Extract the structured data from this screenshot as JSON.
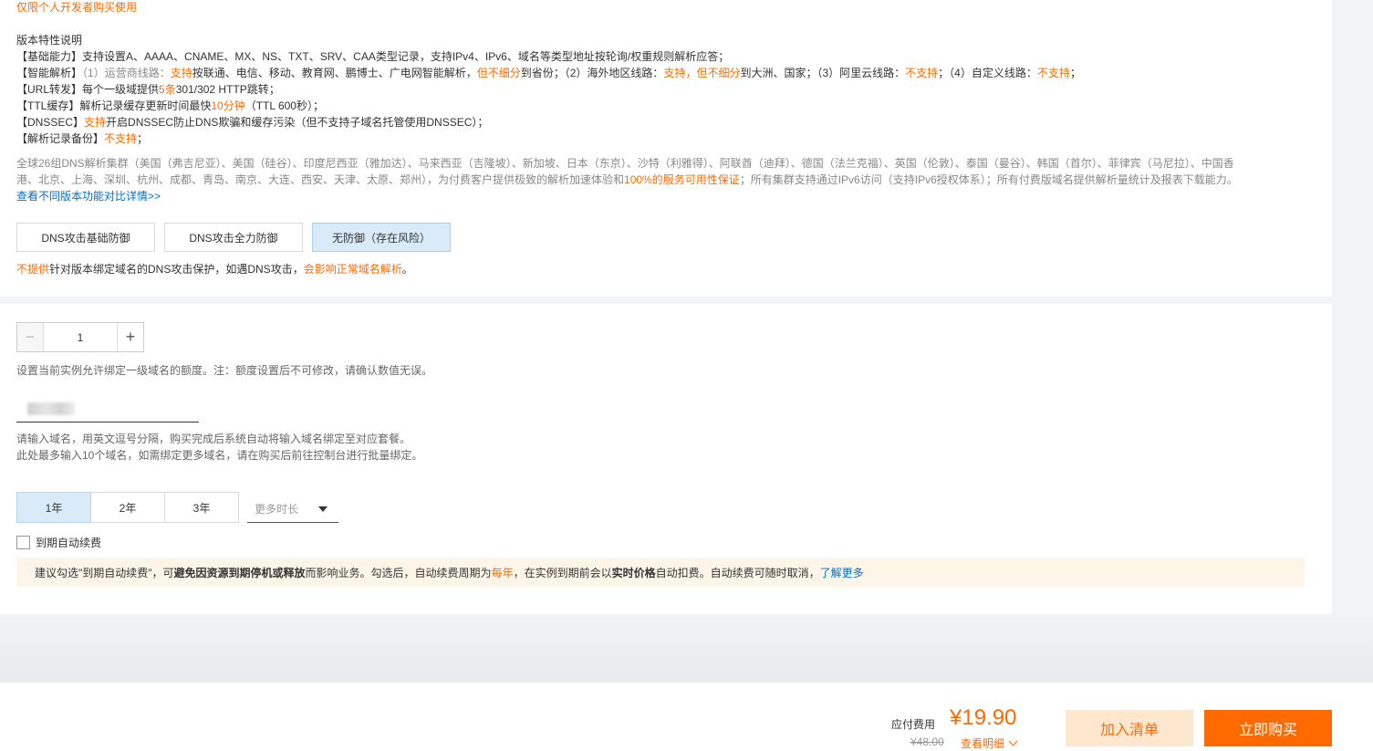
{
  "restriction_note": "仅限个人开发者购买使用",
  "features": {
    "heading": "版本特性说明",
    "basic": {
      "label": "【基础能力】",
      "text": "支持设置A、AAAA、CNAME、MX、NS、TXT、SRV、CAA类型记录，支持IPv4、IPv6、域名等类型地址按轮询/权重规则解析应答；"
    },
    "smart": {
      "label": "【智能解析】",
      "p1": "（1）运营商线路：",
      "p1_hl": "支持",
      "p2": "按联通、电信、移动、教育网、鹏博士、广电网智能解析，",
      "p2_hl": "但不细分",
      "p3": "到省份；（2）海外地区线路：",
      "p3_hl": "支持，但不细分",
      "p4": "到大洲、国家；（3）阿里云线路：",
      "p4_hl": "不支持",
      "p5": "；（4）自定义线路：",
      "p5_hl": "不支持",
      "p6": "；"
    },
    "url": {
      "label": "【URL转发】",
      "p1": "每个一级域提供",
      "hl": "5条",
      "p2": "301/302 HTTP跳转；"
    },
    "ttl": {
      "label": "【TTL缓存】",
      "p1": "解析记录缓存更新时间最快",
      "hl": "10分钟",
      "p2": "（TTL 600秒）；"
    },
    "dnssec": {
      "label": "【DNSSEC】",
      "hl": "支持",
      "p2": "开启DNSSEC防止DNS欺骗和缓存污染（但不支持子域名托管使用DNSSEC）；"
    },
    "backup": {
      "label": "【解析记录备份】",
      "hl": "不支持",
      "p2": "；"
    }
  },
  "cluster_desc": {
    "line1": "全球26组DNS解析集群（美国（弗吉尼亚）、美国（硅谷）、印度尼西亚（雅加达）、马来西亚（吉隆坡）、新加坡、日本（东京）、沙特（利雅得）、阿联酋（迪拜）、德国（法兰克福）、英国（伦敦）、泰国（曼谷）、韩国（首尔）、菲律宾（马尼拉）、中国香",
    "line2_a": "港、北京、上海、深圳、杭州、成都、青岛、南京、大连、西安、天津、太原、郑州），为付费客户提供极致的解析加速体验和",
    "line2_hl": "100%的服务可用性保证",
    "line2_b": "；所有集群支持通过IPv6访问（支持IPv6授权体系）；所有付费版域名提供解析量统计及报表下载能力。"
  },
  "compare_link": "查看不同版本功能对比详情>>",
  "protection": {
    "options": [
      "DNS攻击基础防御",
      "DNS攻击全力防御",
      "无防御（存在风险）"
    ],
    "selected_index": 2,
    "note_hl1": "不提供",
    "note_mid": "针对版本绑定域名的DNS攻击保护，如遇DNS攻击，",
    "note_hl2": "会影响正常域名解析",
    "note_end": "。"
  },
  "quota": {
    "value": "1",
    "minus": "−",
    "plus": "+",
    "note": "设置当前实例允许绑定一级域名的额度。注：额度设置后不可修改，请确认数值无误。"
  },
  "domain": {
    "note1": "请输入域名，用英文逗号分隔，购买完成后系统自动将输入域名绑定至对应套餐。",
    "note2": "此处最多输入10个域名，如需绑定更多域名，请在购买后前往控制台进行批量绑定。"
  },
  "duration": {
    "options": [
      "1年",
      "2年",
      "3年"
    ],
    "selected_index": 0,
    "more_placeholder": "更多时长"
  },
  "autorenew": {
    "label": "到期自动续费",
    "checked": false
  },
  "tip": {
    "p1": "建议勾选\"到期自动续费\"，可",
    "b1": "避免因资源到期停机或释放",
    "p2": "而影响业务。勾选后，自动续费周期为 ",
    "hl": "每年",
    "p3": "，在实例到期前会以",
    "b2": "实时价格",
    "p4": "自动扣费。自动续费可随时取消，",
    "link": "了解更多"
  },
  "checkout": {
    "fee_label": "应付费用",
    "price": "¥19.90",
    "original_price": "¥48.00",
    "detail_link": "查看明细",
    "add_to_list": "加入清单",
    "buy_now": "立即购买"
  },
  "colors": {
    "accent": "#ff6a00",
    "link": "#0070cc",
    "selected_bg": "#d9ebf8",
    "tip_bg": "#fef5e9"
  }
}
